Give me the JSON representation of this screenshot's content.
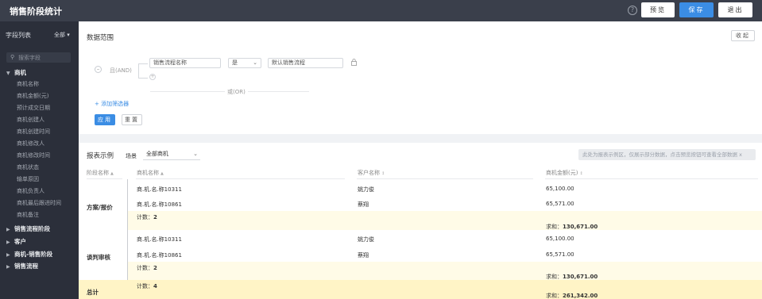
{
  "topbar": {
    "title": "销售阶段统计",
    "help": "?",
    "preview": "预览",
    "save": "保存",
    "exit": "退出"
  },
  "sidebar": {
    "header": "字段列表",
    "filter_all": "全部 ▾",
    "search_placeholder": "搜索字段",
    "groups": [
      {
        "label": "商机",
        "expanded": true,
        "fields": [
          "商机名称",
          "商机金额(元)",
          "预计成交日期",
          "商机创建人",
          "商机创建时间",
          "商机修改人",
          "商机修改时间",
          "商机状态",
          "输单原因",
          "商机负责人",
          "商机最后跟进时间",
          "商机备注"
        ]
      },
      {
        "label": "销售流程阶段",
        "expanded": false
      },
      {
        "label": "客户",
        "expanded": false
      },
      {
        "label": "商机-销售阶段",
        "expanded": false
      },
      {
        "label": "销售流程",
        "expanded": false
      }
    ]
  },
  "data_scope": {
    "title": "数据范围",
    "collapse": "收起",
    "and_label": "且(AND)",
    "filter_field": "销售流程名称",
    "filter_op": "是",
    "filter_value": "默认销售流程",
    "or_label": "或(OR)",
    "add_filter": "+ 添加筛选器",
    "apply": "应用",
    "reset": "重置"
  },
  "report": {
    "title": "报表示例",
    "scene_label": "场景",
    "scene_value": "全部商机",
    "notice": "此处为报表示例区，仅展示部分数据，点击预览按钮可查看全部数据 x",
    "columns": [
      "阶段名称",
      "商机名称",
      "客户名称",
      "商机金额(元)"
    ],
    "groups": [
      {
        "stage": "方案/报价",
        "rows": [
          {
            "name": "商.机.名.称10311",
            "customer": "姚力俊",
            "amount": "65,100.00"
          },
          {
            "name": "商.机.名.称10861",
            "customer": "蔡翔",
            "amount": "65,571.00"
          }
        ],
        "count_label": "计数：",
        "count": "2",
        "sum_label": "求和：",
        "sum": "130,671.00"
      },
      {
        "stage": "谈判审核",
        "rows": [
          {
            "name": "商.机.名.称10311",
            "customer": "姚力俊",
            "amount": "65,100.00"
          },
          {
            "name": "商.机.名.称10861",
            "customer": "蔡翔",
            "amount": "65,571.00"
          }
        ],
        "count_label": "计数：",
        "count": "2",
        "sum_label": "求和：",
        "sum": "130,671.00"
      }
    ],
    "total": {
      "stage": "总计",
      "count_label": "计数：",
      "count": "4",
      "sum_label": "求和：",
      "sum": "261,342.00"
    }
  },
  "colors": {
    "topbar": "#3a3f4b",
    "sidebar": "#2b2f3a",
    "accent": "#3b8de4",
    "summary_row": "#fffbe7"
  }
}
